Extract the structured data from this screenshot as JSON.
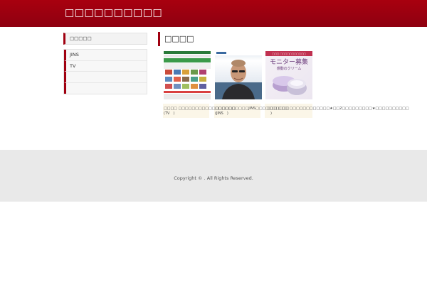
{
  "header": {
    "site_title": "□□□□□□□□□□"
  },
  "sidebar": {
    "heading": "□□□□□",
    "items": [
      {
        "label": "JINS"
      },
      {
        "label": "TV"
      },
      {
        "label": ""
      },
      {
        "label": ""
      }
    ]
  },
  "main": {
    "heading": "□□□□",
    "cards": [
      {
        "caption_line1": "□□□□ □□□□□□□□□□□□□□□□□",
        "caption_line2": "(TV　)"
      },
      {
        "caption_line1": "□□□□□□□□□□JINS□□□□□□□□□□",
        "caption_line2": "(JINS　)"
      },
      {
        "caption_line1": "□□□ □□□ □□□□□□□□□□□□★□□2□□□□□□□□□★□□□□□□□□□□",
        "caption_line2": "　)"
      }
    ],
    "ad_text": {
      "top": "□□□ □□□□□□□□□□□",
      "big": "モニター募集",
      "sub": "感動のクリーム"
    }
  },
  "footer": {
    "copyright": "Copyright © . All Rights Reserved."
  },
  "colors": {
    "header": "#9a0010",
    "accent": "#a00010",
    "footer_bg": "#e9e9e9"
  }
}
